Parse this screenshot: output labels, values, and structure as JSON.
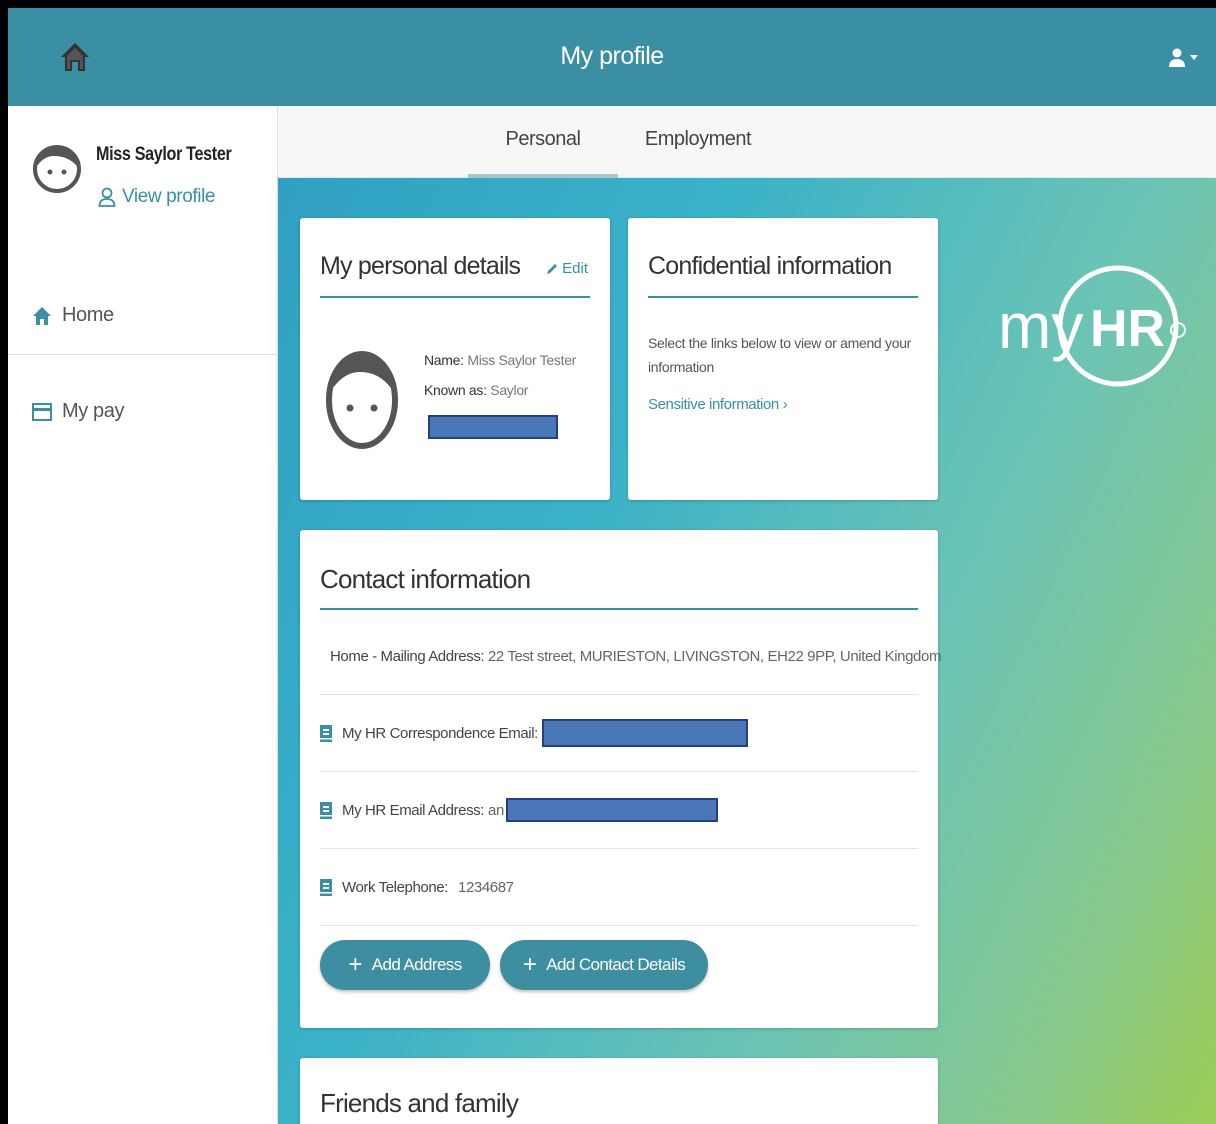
{
  "header": {
    "title": "My profile"
  },
  "sidebar": {
    "user_name": "Miss Saylor Tester",
    "view_profile": "View profile",
    "items": [
      {
        "label": "Home",
        "icon": "home-icon"
      },
      {
        "label": "My pay",
        "icon": "card-icon"
      }
    ]
  },
  "tabs": [
    {
      "label": "Personal",
      "active": true
    },
    {
      "label": "Employment",
      "active": false
    }
  ],
  "personal_details": {
    "title": "My personal details",
    "edit_label": "Edit",
    "name_label": "Name:",
    "name_value": "Miss Saylor Tester",
    "known_label": "Known as:",
    "known_value": "Saylor"
  },
  "confidential": {
    "title": "Confidential information",
    "description": "Select the links below to view or amend your information",
    "link": "Sensitive information"
  },
  "contact": {
    "title": "Contact information",
    "rows": [
      {
        "label": "Home - Mailing Address:",
        "value": "22 Test street, MURIESTON, LIVINGSTON, EH22 9PP, United Kingdom",
        "icon": "address-card-icon"
      },
      {
        "label": "My HR Correspondence Email:",
        "value": "",
        "icon": "contact-icon"
      },
      {
        "label": "My HR Email Address:",
        "value": "an",
        "icon": "contact-icon"
      },
      {
        "label": "Work Telephone:",
        "value": "1234687",
        "icon": "contact-icon"
      }
    ],
    "add_address": "Add Address",
    "add_contact": "Add Contact Details"
  },
  "friends": {
    "title": "Friends and family"
  },
  "brand": {
    "my": "my",
    "hr": "HR"
  },
  "colors": {
    "header": "#3a8fa3",
    "accent": "#3a8fa3",
    "redaction": "#4a77b8"
  }
}
